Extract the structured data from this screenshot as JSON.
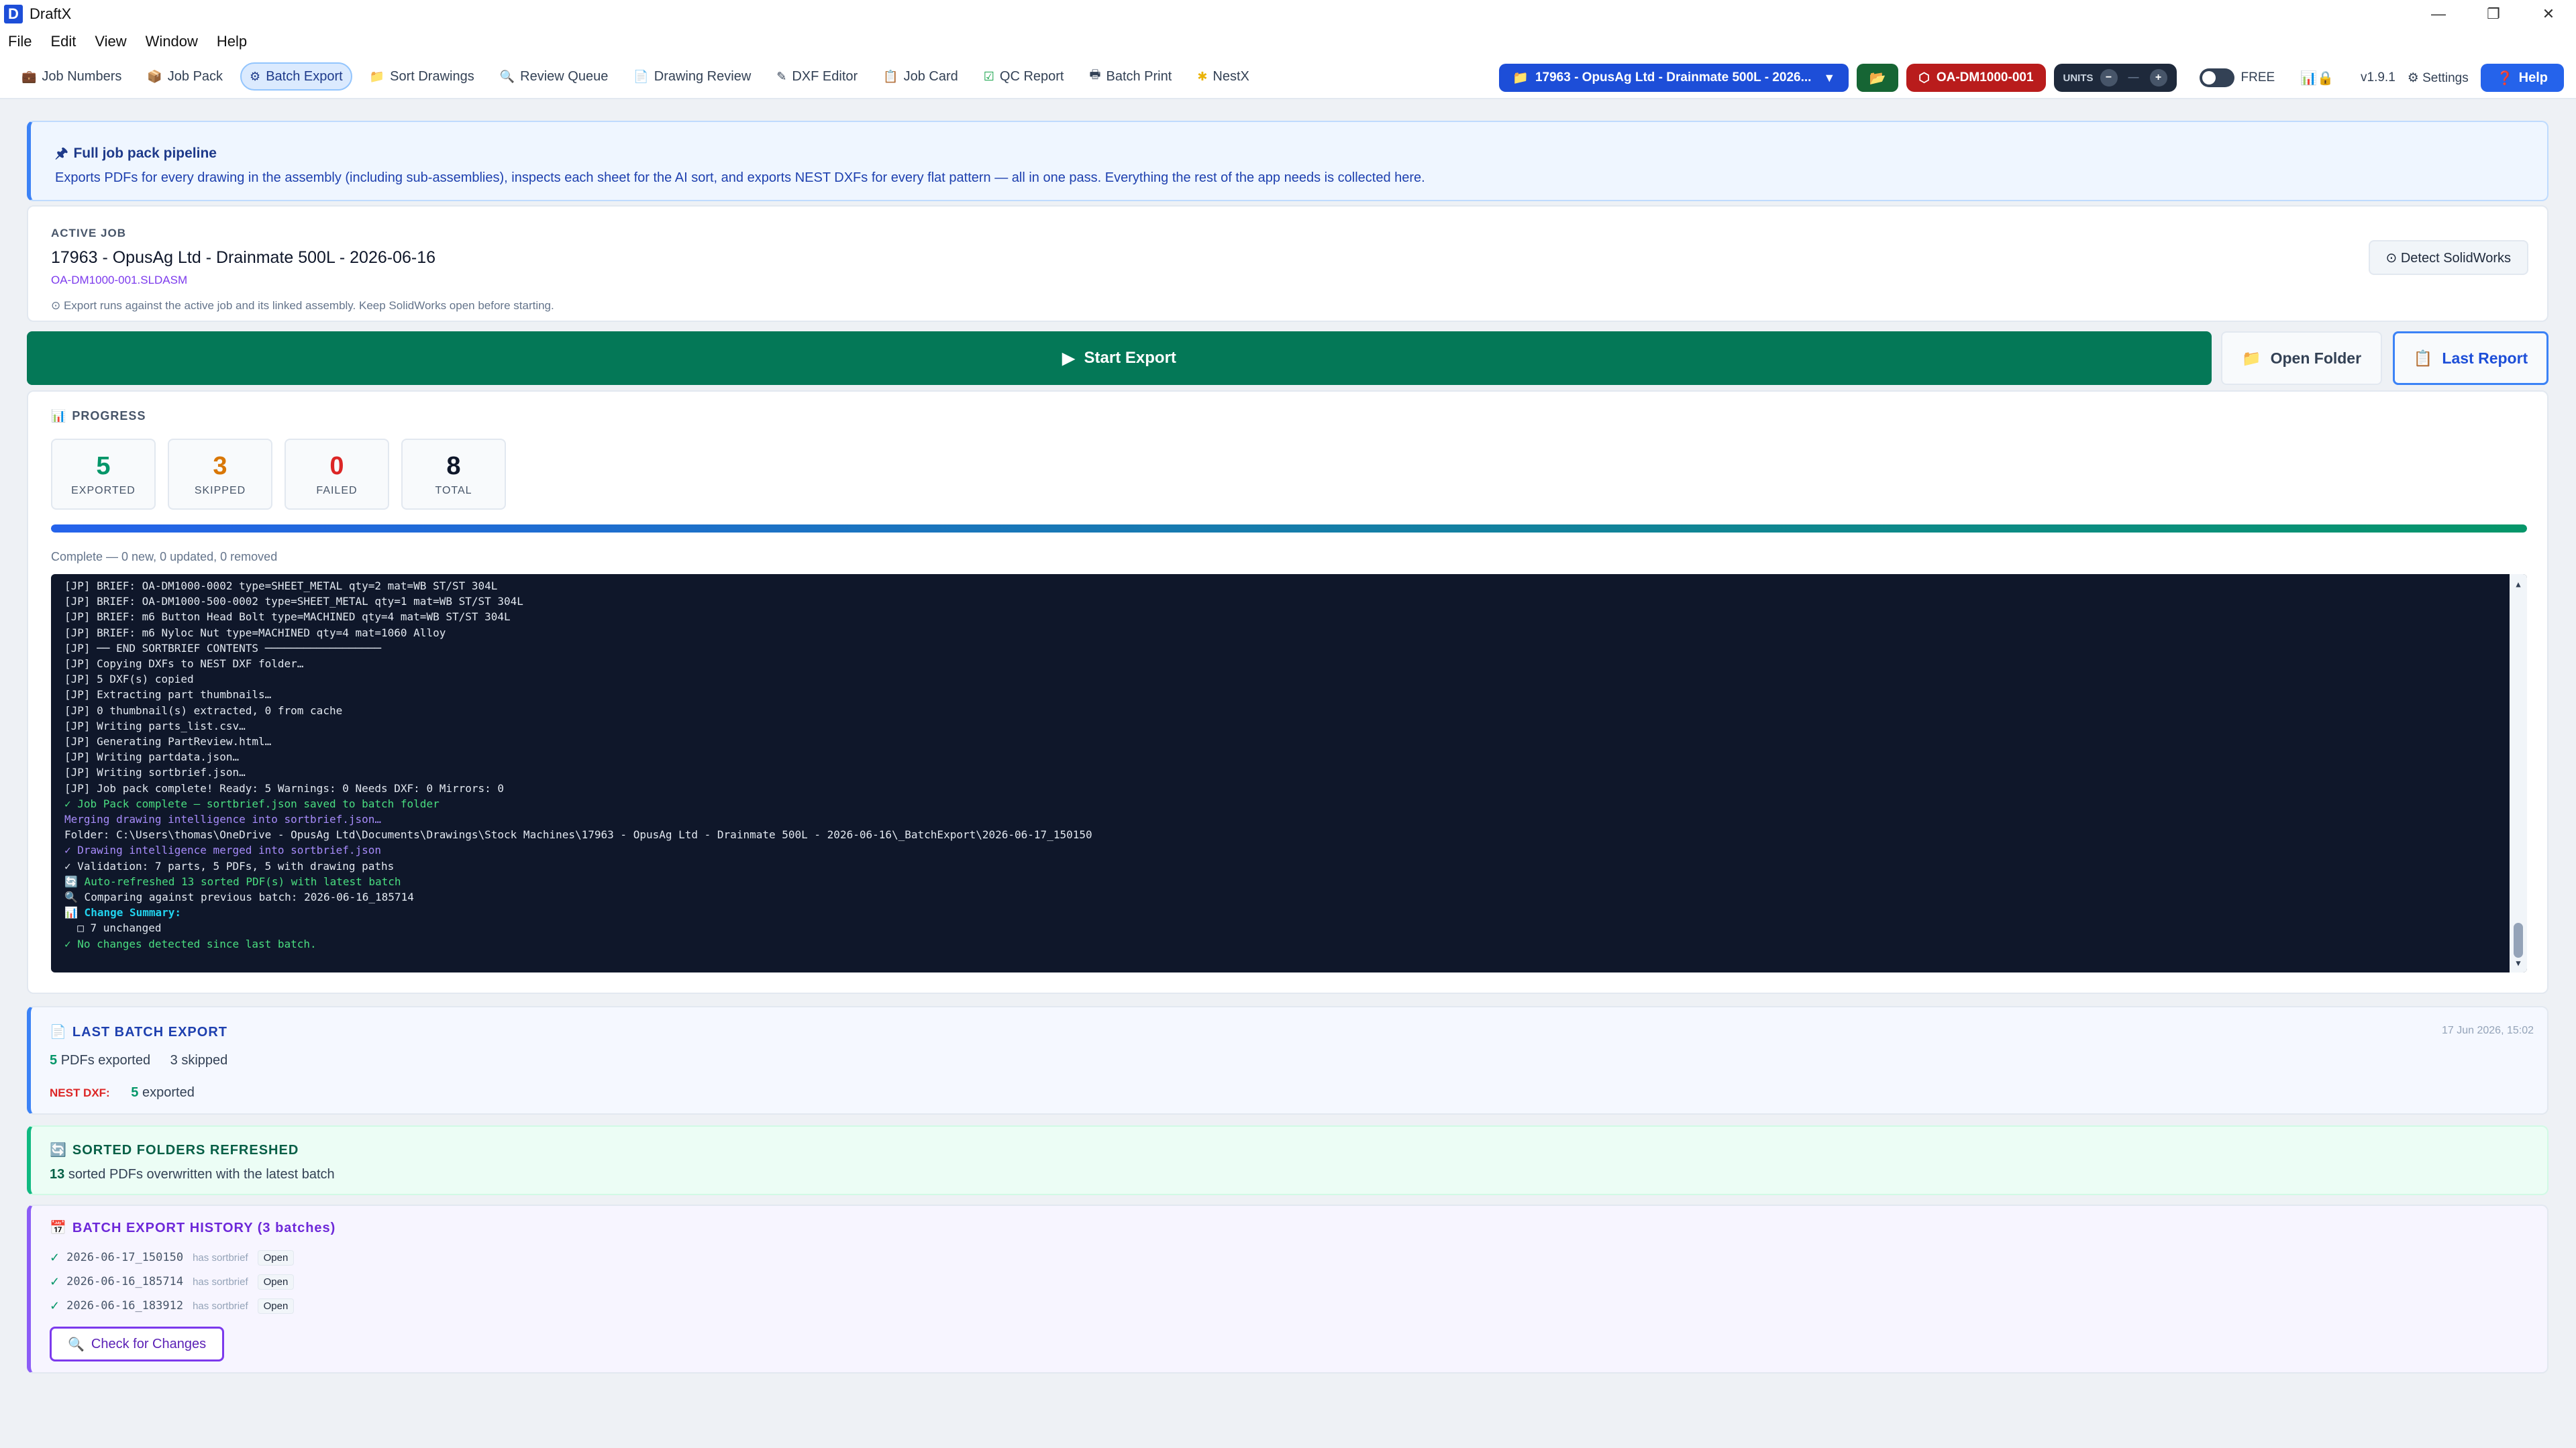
{
  "window": {
    "title": "DraftX",
    "logo_letter": "D",
    "minimize": "—",
    "restore": "❐",
    "close": "✕"
  },
  "menu": [
    "File",
    "Edit",
    "View",
    "Window",
    "Help"
  ],
  "nav_tabs": [
    {
      "label": "Job Numbers",
      "icon": "💼"
    },
    {
      "label": "Job Pack",
      "icon": "📦"
    },
    {
      "label": "Batch Export",
      "icon": "⚙"
    },
    {
      "label": "Sort Drawings",
      "icon": "📁"
    },
    {
      "label": "Review Queue",
      "icon": "🔍"
    },
    {
      "label": "Drawing Review",
      "icon": "📄"
    },
    {
      "label": "DXF Editor",
      "icon": "✎"
    },
    {
      "label": "Job Card",
      "icon": "📋"
    },
    {
      "label": "QC Report",
      "icon": "☑"
    },
    {
      "label": "Batch Print",
      "icon": "🖶"
    },
    {
      "label": "NestX",
      "icon": "✱"
    }
  ],
  "toolbar": {
    "job_selector": "17963 - OpusAg Ltd - Drainmate 500L - 2026...",
    "job_caret": "▼",
    "folder_icon": "📂",
    "assembly_chip": "OA-DM1000-001",
    "assembly_icon": "⬡",
    "units_label": "UNITS",
    "units_minus": "−",
    "units_value": "—",
    "units_plus": "+",
    "license": "FREE",
    "status_icons": "📊🔒",
    "version": "v1.9.1",
    "settings": "⚙ Settings",
    "help": "Help",
    "help_icon": "❓"
  },
  "pipeline": {
    "title": "Full job pack pipeline",
    "title_icon": "🖈",
    "description": "Exports PDFs for every drawing in the assembly (including sub-assemblies), inspects each sheet for the AI sort, and exports NEST DXFs for every flat pattern — all in one pass. Everything the rest of the app needs is collected here."
  },
  "active_job": {
    "label": "ACTIVE JOB",
    "name": "17963 - OpusAg Ltd - Drainmate 500L - 2026-06-16",
    "assembly_file": "OA-DM1000-001.SLDASM",
    "note": "⊙ Export runs against the active job and its linked assembly. Keep SolidWorks open before starting.",
    "detect_button": "⊙ Detect SolidWorks"
  },
  "actions": {
    "start_export": "Start Export",
    "start_icon": "▶",
    "open_folder": "Open Folder",
    "open_folder_icon": "📁",
    "last_report": "Last Report",
    "last_report_icon": "📋"
  },
  "progress": {
    "title": "PROGRESS",
    "title_icon": "📊",
    "stats": [
      {
        "value": "5",
        "label": "EXPORTED",
        "color": "#059669"
      },
      {
        "value": "3",
        "label": "SKIPPED",
        "color": "#d97706"
      },
      {
        "value": "0",
        "label": "FAILED",
        "color": "#dc2626"
      },
      {
        "value": "8",
        "label": "TOTAL",
        "color": "#0f172a"
      }
    ],
    "fraction": 1.0,
    "status": "Complete — 0 new, 0 updated, 0 removed"
  },
  "console": {
    "lines": [
      {
        "text": "[JP] BRIEF: OA-DM1000-0002 type=SHEET_METAL qty=2 mat=WB ST/ST 304L",
        "style": ""
      },
      {
        "text": "[JP] BRIEF: OA-DM1000-500-0002 type=SHEET_METAL qty=1 mat=WB ST/ST 304L",
        "style": ""
      },
      {
        "text": "[JP] BRIEF: m6 Button Head Bolt type=MACHINED qty=4 mat=WB ST/ST 304L",
        "style": ""
      },
      {
        "text": "[JP] BRIEF: m6 Nyloc Nut type=MACHINED qty=4 mat=1060 Alloy",
        "style": ""
      },
      {
        "text": "[JP] ── END SORTBRIEF CONTENTS ──────────────────",
        "style": ""
      },
      {
        "text": "[JP] Copying DXFs to NEST DXF folder…",
        "style": ""
      },
      {
        "text": "[JP] 5 DXF(s) copied",
        "style": ""
      },
      {
        "text": "[JP] Extracting part thumbnails…",
        "style": ""
      },
      {
        "text": "[JP] 0 thumbnail(s) extracted, 0 from cache",
        "style": ""
      },
      {
        "text": "[JP] Writing parts_list.csv…",
        "style": ""
      },
      {
        "text": "[JP] Generating PartReview.html…",
        "style": ""
      },
      {
        "text": "[JP] Writing partdata.json…",
        "style": ""
      },
      {
        "text": "[JP] Writing sortbrief.json…",
        "style": ""
      },
      {
        "text": "[JP] Job pack complete! Ready: 5 Warnings: 0 Needs DXF: 0 Mirrors: 0",
        "style": ""
      },
      {
        "text": "✓ Job Pack complete — sortbrief.json saved to batch folder",
        "style": "green"
      },
      {
        "text": "Merging drawing intelligence into sortbrief.json…",
        "style": "purple"
      },
      {
        "text": "Folder: C:\\Users\\thomas\\OneDrive - OpusAg Ltd\\Documents\\Drawings\\Stock Machines\\17963 - OpusAg Ltd - Drainmate 500L - 2026-06-16\\_BatchExport\\2026-06-17_150150",
        "style": ""
      },
      {
        "text": "✓ Drawing intelligence merged into sortbrief.json",
        "style": "purple"
      },
      {
        "text": "✓ Validation: 7 parts, 5 PDFs, 5 with drawing paths",
        "style": ""
      },
      {
        "text": "🔄 Auto-refreshed 13 sorted PDF(s) with latest batch",
        "style": "green"
      },
      {
        "text": "🔍 Comparing against previous batch: 2026-06-16_185714",
        "style": ""
      },
      {
        "text": "📊 Change Summary:",
        "style": "cyan"
      },
      {
        "text": "  □ 7 unchanged",
        "style": ""
      },
      {
        "text": "✓ No changes detected since last batch.",
        "style": "green"
      }
    ],
    "scroll_up": "▲",
    "scroll_down": "▼"
  },
  "last_batch": {
    "title": "LAST BATCH EXPORT",
    "title_icon": "📄",
    "date": "17 Jun 2026, 15:02",
    "pdfs_count": "5",
    "pdfs_text": "PDFs exported",
    "skipped_text": "3 skipped",
    "nest_label": "NEST DXF:",
    "nest_count": "5",
    "nest_text": "exported"
  },
  "sorted_folders": {
    "title": "SORTED FOLDERS REFRESHED",
    "title_icon": "🔄",
    "count": "13",
    "text": "sorted PDFs overwritten with the latest batch"
  },
  "history": {
    "title": "BATCH EXPORT HISTORY (3 batches)",
    "title_icon": "📅",
    "rows": [
      {
        "check": "✓",
        "timestamp": "2026-06-17_150150",
        "badge": "has sortbrief",
        "open": "Open"
      },
      {
        "check": "✓",
        "timestamp": "2026-06-16_185714",
        "badge": "has sortbrief",
        "open": "Open"
      },
      {
        "check": "✓",
        "timestamp": "2026-06-16_183912",
        "badge": "has sortbrief",
        "open": "Open"
      }
    ],
    "check_button": "Check for Changes",
    "check_icon": "🔍"
  }
}
